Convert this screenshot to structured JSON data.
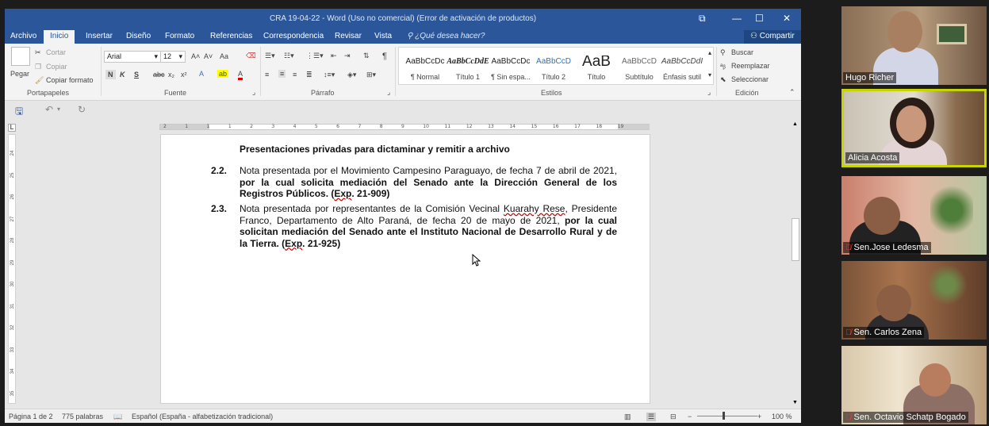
{
  "window": {
    "title": "CRA 19-04-22 - Word (Uso no comercial) (Error de activación de productos)",
    "min": "—",
    "max": "☐",
    "close": "✕",
    "ribbon_icon": "⧉"
  },
  "tabs": [
    "Archivo",
    "Inicio",
    "Insertar",
    "Diseño",
    "Formato",
    "Referencias",
    "Correspondencia",
    "Revisar",
    "Vista"
  ],
  "tell_me": "¿Qué desea hacer?",
  "share": "Compartir",
  "clipboard": {
    "paste": "Pegar",
    "cut": "Cortar",
    "copy": "Copiar",
    "format_painter": "Copiar formato",
    "label": "Portapapeles"
  },
  "font": {
    "name": "Arial",
    "size": "12",
    "grow": "A˄",
    "shrink": "A˅",
    "case": "Aa",
    "bold": "N",
    "italic": "K",
    "underline": "S",
    "strike": "abc",
    "sub": "x₂",
    "sup": "x²",
    "label": "Fuente"
  },
  "paragraph": {
    "label": "Párrafo",
    "pilcrow": "¶"
  },
  "styles": {
    "label": "Estilos",
    "items": [
      {
        "sample": "AaBbCcDc",
        "name": "¶ Normal"
      },
      {
        "sample": "AaBbCcDdE",
        "name": "Título 1"
      },
      {
        "sample": "AaBbCcDc",
        "name": "¶ Sin espa..."
      },
      {
        "sample": "AaBbCcD",
        "name": "Título 2"
      },
      {
        "sample": "AaB",
        "name": "Título"
      },
      {
        "sample": "AaBbCcD",
        "name": "Subtítulo"
      },
      {
        "sample": "AaBbCcDdI",
        "name": "Énfasis sutil"
      }
    ]
  },
  "editing": {
    "find": "Buscar",
    "replace": "Reemplazar",
    "select": "Seleccionar",
    "label": "Edición"
  },
  "ruler": [
    "2",
    "1",
    "1",
    "1",
    "2",
    "3",
    "4",
    "5",
    "6",
    "7",
    "8",
    "9",
    "10",
    "11",
    "12",
    "13",
    "14",
    "15",
    "16",
    "17",
    "18",
    "19"
  ],
  "vruler": [
    "24",
    "25",
    "26",
    "27",
    "28",
    "29",
    "30",
    "31",
    "32",
    "33",
    "34",
    "35"
  ],
  "document": {
    "heading": "Presentaciones privadas para dictaminar y remitir a archivo",
    "items": [
      {
        "num": "2.2.",
        "normal": "Nota presentada por el Movimiento Campesino Paraguayo, de fecha 7 de abril de 2021, ",
        "bold": "por la cual solicita mediación del Senado ante la Dirección General de los Registros Públicos. (",
        "exp": "Exp",
        "bold_end": ". 21-909)"
      },
      {
        "num": "2.3.",
        "normal1": "Nota presentada por representantes de la Comisión Vecinal ",
        "sq1": "Kuarahy Rese",
        "normal2": ", Presidente Franco, Departamento de Alto Paraná, de fecha 20 de mayo de 2021, ",
        "bold": "por la cual solicitan mediación del Senado ante el Instituto Nacional de Desarrollo Rural y de la Tierra.  (",
        "exp": "Exp",
        "bold_end": ". 21-925)"
      }
    ]
  },
  "status": {
    "page": "Página 1 de 2",
    "words": "775 palabras",
    "language": "Español (España - alfabetización tradicional)",
    "zoom": "100 %",
    "minus": "−",
    "plus": "+"
  },
  "participants": [
    {
      "name": "Hugo Richer",
      "muted": false,
      "active": false
    },
    {
      "name": "Alicia Acosta",
      "muted": false,
      "active": true
    },
    {
      "name": "Sen.Jose Ledesma",
      "muted": true,
      "active": false
    },
    {
      "name": "Sen. Carlos Zena",
      "muted": true,
      "active": false
    },
    {
      "name": "Sen. Octavio Schatp Bogado",
      "muted": true,
      "active": false
    }
  ],
  "colors": {
    "word_blue": "#2b579a",
    "active_border": "#c8d400"
  }
}
